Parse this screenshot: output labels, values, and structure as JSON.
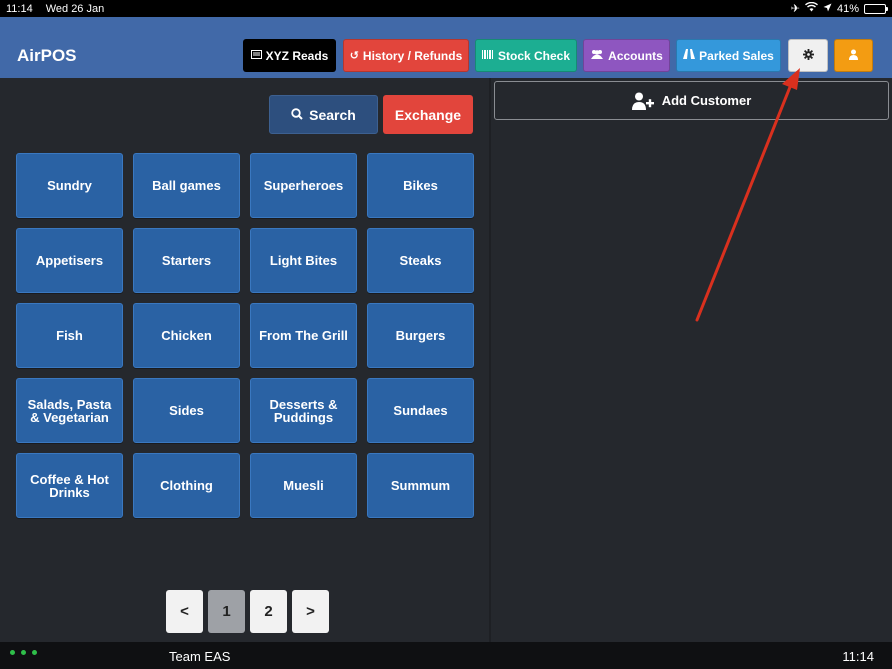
{
  "status_bar": {
    "time": "11:14",
    "date": "Wed 26 Jan",
    "battery": "41%",
    "battery_level": 0.41,
    "icons": [
      "airplane-icon",
      "wifi-icon",
      "location-icon",
      "battery-icon"
    ]
  },
  "header": {
    "brand": "AirPOS",
    "buttons": {
      "xyz": "XYZ Reads",
      "history": "History / Refunds",
      "stock": "Stock Check",
      "accounts": "Accounts",
      "parked": "Parked Sales"
    },
    "colors": {
      "bar": "#4169a8",
      "xyz": "#000000",
      "history": "#e2453c",
      "stock": "#1cae92",
      "accounts": "#8e56c0",
      "parked": "#3498db",
      "settings": "#f0f0f0",
      "user": "#f39c12"
    }
  },
  "actions": {
    "search": "Search",
    "exchange": "Exchange"
  },
  "categories": [
    "Sundry",
    "Ball games",
    "Superheroes",
    "Bikes",
    "Appetisers",
    "Starters",
    "Light Bites",
    "Steaks",
    "Fish",
    "Chicken",
    "From The Grill",
    "Burgers",
    "Salads, Pasta & Vegetarian",
    "Sides",
    "Desserts & Puddings",
    "Sundaes",
    "Coffee & Hot Drinks",
    "Clothing",
    "Muesli",
    "Summum"
  ],
  "pagination": {
    "prev": "<",
    "pages": [
      "1",
      "2"
    ],
    "current": "1",
    "next": ">"
  },
  "customer": {
    "add_label": "Add Customer"
  },
  "annotation": {
    "color": "#d9301e",
    "points_to": "settings-button"
  },
  "footer": {
    "team": "Team EAS",
    "time": "11:14"
  }
}
